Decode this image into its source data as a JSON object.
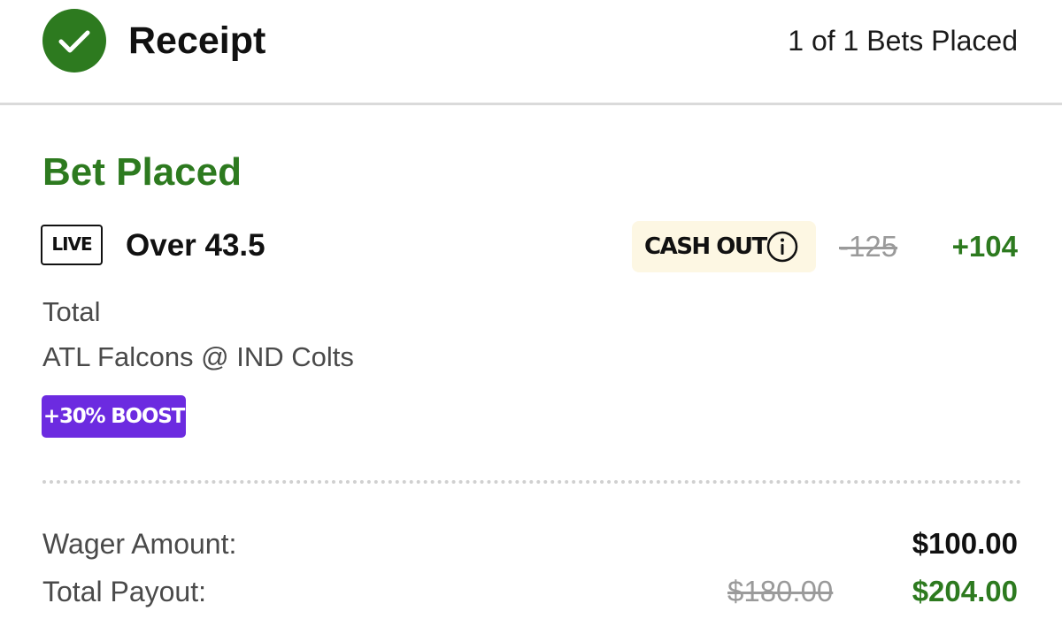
{
  "header": {
    "title": "Receipt",
    "bets_placed": "1 of 1 Bets Placed",
    "icon": "check-circle-icon"
  },
  "bet": {
    "status": "Bet Placed",
    "live_badge": "LIVE",
    "selection": "Over 43.5",
    "cash_out_label": "CASH OUT",
    "info_icon": "info-icon",
    "old_odds": "-125",
    "new_odds": "+104",
    "market": "Total",
    "event": "ATL Falcons @ IND Colts",
    "boost": "+30% BOOST"
  },
  "summary": {
    "wager_label": "Wager Amount:",
    "wager_value": "$100.00",
    "payout_label": "Total Payout:",
    "old_payout": "$180.00",
    "new_payout": "$204.00"
  },
  "colors": {
    "success_green": "#2d7a1f",
    "boost_purple": "#6c2be0",
    "cashout_bg": "#fdf7e3",
    "muted_gray": "#9a9a9a"
  }
}
